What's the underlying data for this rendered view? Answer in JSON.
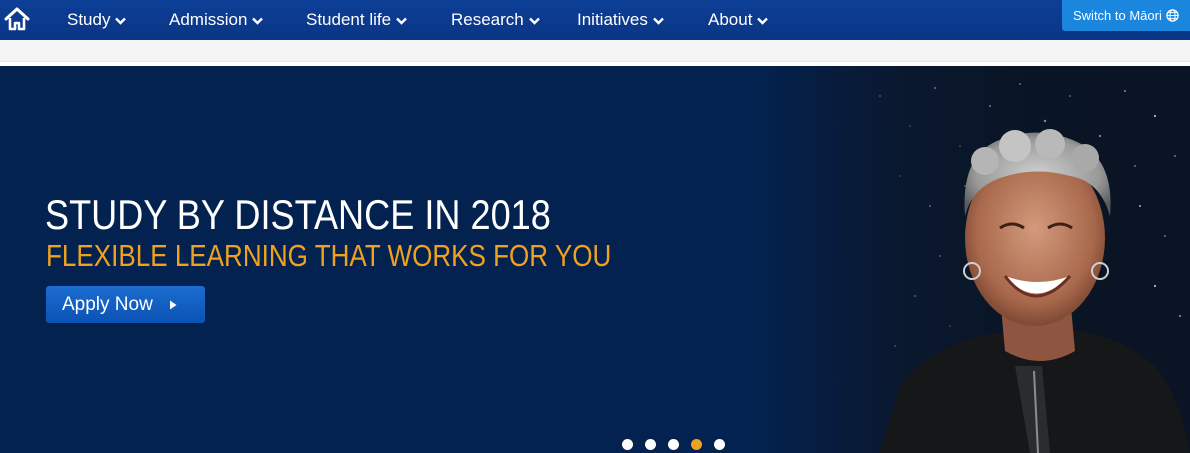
{
  "nav": {
    "home_icon": "home-icon",
    "items": [
      {
        "label": "Study"
      },
      {
        "label": "Admission"
      },
      {
        "label": "Student life"
      },
      {
        "label": "Research"
      },
      {
        "label": "Initiatives"
      },
      {
        "label": "About"
      }
    ],
    "switch_label": "Switch to Māori",
    "switch_icon": "globe-icon"
  },
  "hero": {
    "headline": "STUDY BY DISTANCE IN 2018",
    "subline": "FLEXIBLE LEARNING THAT WORKS FOR YOU",
    "cta_label": "Apply Now",
    "slide_count": 5,
    "active_slide": 4
  },
  "colors": {
    "nav_bg": "#0b3a8f",
    "hero_bg": "#03224f",
    "accent_orange": "#f0a21e",
    "switch_blue": "#1a86dd",
    "button_blue": "#1060c2"
  }
}
